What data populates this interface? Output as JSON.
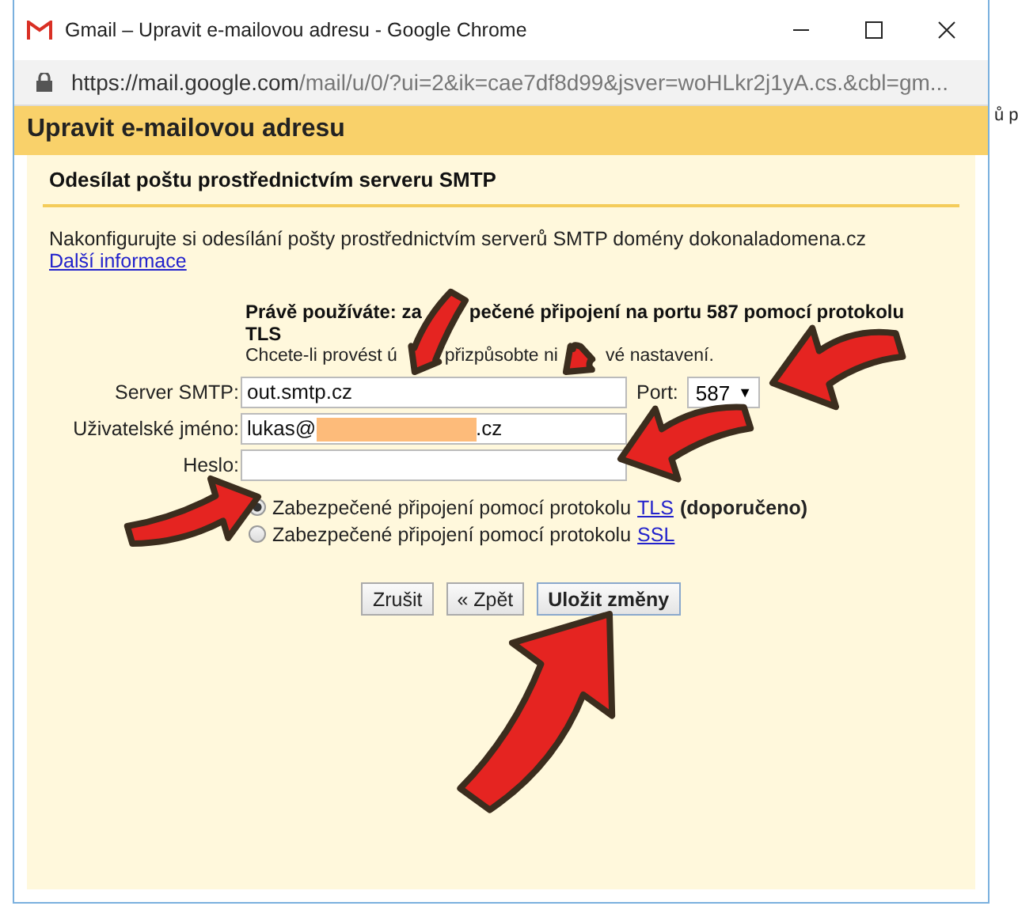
{
  "window": {
    "title": "Gmail – Upravit e-mailovou adresu - Google Chrome",
    "url_host": "https://mail.google.com",
    "url_rest": "/mail/u/0/?ui=2&ik=cae7df8d99&jsver=woHLkr2j1yA.cs.&cbl=gm..."
  },
  "background_text": "ů p",
  "dialog": {
    "title": "Upravit e-mailovou adresu",
    "section": "Odesílat poštu prostřednictvím serveru SMTP",
    "intro": "Nakonfigurujte si odesílání pošty prostřednictvím serverů SMTP domény dokonaladomena.cz",
    "more_link": "Další informace",
    "current_lines": [
      [
        "Právě používáte: za",
        "pečené připojení na portu 587 pomocí protokolu"
      ],
      [
        "TLS"
      ]
    ],
    "hint_parts": [
      "Chcete-li provést ú",
      "přizpůsobte ni",
      "vé nastavení."
    ],
    "fields": [
      {
        "kind": "text",
        "label": "Server SMTP:",
        "value": "out.smtp.cz"
      },
      {
        "kind": "redacted",
        "label": "Uživatelské jméno:",
        "value_start": "lukas@",
        "value_end": ".cz"
      },
      {
        "kind": "password",
        "label": "Heslo:"
      }
    ],
    "port": {
      "label": "Port:",
      "value": "587",
      "caret": "▼"
    },
    "security": [
      {
        "text": "Zabezpečené připojení pomocí protokolu",
        "link": "TLS",
        "note": "(doporučeno)",
        "selected": true
      },
      {
        "text": "Zabezpečené připojení pomocí protokolu",
        "link": "SSL",
        "selected": false
      }
    ],
    "buttons": [
      "Zrušit",
      "« Zpět",
      "Uložit změny"
    ]
  }
}
